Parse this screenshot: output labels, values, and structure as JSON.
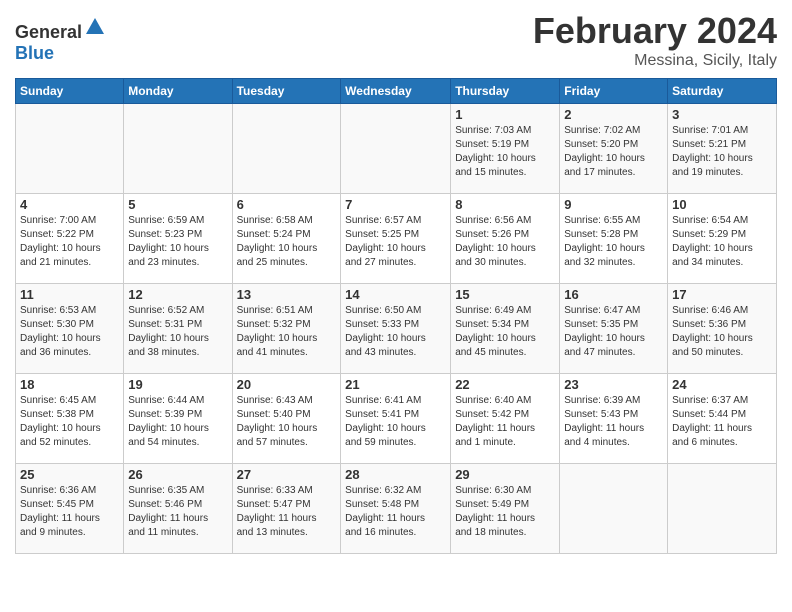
{
  "logo": {
    "text_general": "General",
    "text_blue": "Blue"
  },
  "title": "February 2024",
  "subtitle": "Messina, Sicily, Italy",
  "days_of_week": [
    "Sunday",
    "Monday",
    "Tuesday",
    "Wednesday",
    "Thursday",
    "Friday",
    "Saturday"
  ],
  "weeks": [
    [
      {
        "day": "",
        "info": ""
      },
      {
        "day": "",
        "info": ""
      },
      {
        "day": "",
        "info": ""
      },
      {
        "day": "",
        "info": ""
      },
      {
        "day": "1",
        "info": "Sunrise: 7:03 AM\nSunset: 5:19 PM\nDaylight: 10 hours\nand 15 minutes."
      },
      {
        "day": "2",
        "info": "Sunrise: 7:02 AM\nSunset: 5:20 PM\nDaylight: 10 hours\nand 17 minutes."
      },
      {
        "day": "3",
        "info": "Sunrise: 7:01 AM\nSunset: 5:21 PM\nDaylight: 10 hours\nand 19 minutes."
      }
    ],
    [
      {
        "day": "4",
        "info": "Sunrise: 7:00 AM\nSunset: 5:22 PM\nDaylight: 10 hours\nand 21 minutes."
      },
      {
        "day": "5",
        "info": "Sunrise: 6:59 AM\nSunset: 5:23 PM\nDaylight: 10 hours\nand 23 minutes."
      },
      {
        "day": "6",
        "info": "Sunrise: 6:58 AM\nSunset: 5:24 PM\nDaylight: 10 hours\nand 25 minutes."
      },
      {
        "day": "7",
        "info": "Sunrise: 6:57 AM\nSunset: 5:25 PM\nDaylight: 10 hours\nand 27 minutes."
      },
      {
        "day": "8",
        "info": "Sunrise: 6:56 AM\nSunset: 5:26 PM\nDaylight: 10 hours\nand 30 minutes."
      },
      {
        "day": "9",
        "info": "Sunrise: 6:55 AM\nSunset: 5:28 PM\nDaylight: 10 hours\nand 32 minutes."
      },
      {
        "day": "10",
        "info": "Sunrise: 6:54 AM\nSunset: 5:29 PM\nDaylight: 10 hours\nand 34 minutes."
      }
    ],
    [
      {
        "day": "11",
        "info": "Sunrise: 6:53 AM\nSunset: 5:30 PM\nDaylight: 10 hours\nand 36 minutes."
      },
      {
        "day": "12",
        "info": "Sunrise: 6:52 AM\nSunset: 5:31 PM\nDaylight: 10 hours\nand 38 minutes."
      },
      {
        "day": "13",
        "info": "Sunrise: 6:51 AM\nSunset: 5:32 PM\nDaylight: 10 hours\nand 41 minutes."
      },
      {
        "day": "14",
        "info": "Sunrise: 6:50 AM\nSunset: 5:33 PM\nDaylight: 10 hours\nand 43 minutes."
      },
      {
        "day": "15",
        "info": "Sunrise: 6:49 AM\nSunset: 5:34 PM\nDaylight: 10 hours\nand 45 minutes."
      },
      {
        "day": "16",
        "info": "Sunrise: 6:47 AM\nSunset: 5:35 PM\nDaylight: 10 hours\nand 47 minutes."
      },
      {
        "day": "17",
        "info": "Sunrise: 6:46 AM\nSunset: 5:36 PM\nDaylight: 10 hours\nand 50 minutes."
      }
    ],
    [
      {
        "day": "18",
        "info": "Sunrise: 6:45 AM\nSunset: 5:38 PM\nDaylight: 10 hours\nand 52 minutes."
      },
      {
        "day": "19",
        "info": "Sunrise: 6:44 AM\nSunset: 5:39 PM\nDaylight: 10 hours\nand 54 minutes."
      },
      {
        "day": "20",
        "info": "Sunrise: 6:43 AM\nSunset: 5:40 PM\nDaylight: 10 hours\nand 57 minutes."
      },
      {
        "day": "21",
        "info": "Sunrise: 6:41 AM\nSunset: 5:41 PM\nDaylight: 10 hours\nand 59 minutes."
      },
      {
        "day": "22",
        "info": "Sunrise: 6:40 AM\nSunset: 5:42 PM\nDaylight: 11 hours\nand 1 minute."
      },
      {
        "day": "23",
        "info": "Sunrise: 6:39 AM\nSunset: 5:43 PM\nDaylight: 11 hours\nand 4 minutes."
      },
      {
        "day": "24",
        "info": "Sunrise: 6:37 AM\nSunset: 5:44 PM\nDaylight: 11 hours\nand 6 minutes."
      }
    ],
    [
      {
        "day": "25",
        "info": "Sunrise: 6:36 AM\nSunset: 5:45 PM\nDaylight: 11 hours\nand 9 minutes."
      },
      {
        "day": "26",
        "info": "Sunrise: 6:35 AM\nSunset: 5:46 PM\nDaylight: 11 hours\nand 11 minutes."
      },
      {
        "day": "27",
        "info": "Sunrise: 6:33 AM\nSunset: 5:47 PM\nDaylight: 11 hours\nand 13 minutes."
      },
      {
        "day": "28",
        "info": "Sunrise: 6:32 AM\nSunset: 5:48 PM\nDaylight: 11 hours\nand 16 minutes."
      },
      {
        "day": "29",
        "info": "Sunrise: 6:30 AM\nSunset: 5:49 PM\nDaylight: 11 hours\nand 18 minutes."
      },
      {
        "day": "",
        "info": ""
      },
      {
        "day": "",
        "info": ""
      }
    ]
  ]
}
